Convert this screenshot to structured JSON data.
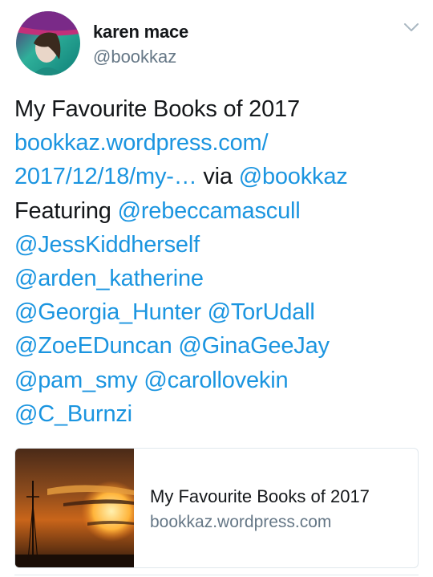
{
  "author": {
    "display_name": "karen mace",
    "handle": "@bookkaz"
  },
  "menu_icon": "chevron-down-icon",
  "tweet_lines": [
    [
      {
        "text": "My Favourite Books of 2017",
        "kind": "text"
      }
    ],
    [
      {
        "text": "bookkaz.wordpress.com/",
        "kind": "link"
      }
    ],
    [
      {
        "text": "2017/12/18/my-…",
        "kind": "link"
      },
      {
        "text": " via ",
        "kind": "text"
      },
      {
        "text": "@bookkaz",
        "kind": "link"
      }
    ],
    [
      {
        "text": "Featuring ",
        "kind": "text"
      },
      {
        "text": "@rebeccamascull",
        "kind": "link"
      }
    ],
    [
      {
        "text": "@JessKiddherself",
        "kind": "link"
      }
    ],
    [
      {
        "text": "@arden_katherine",
        "kind": "link"
      }
    ],
    [
      {
        "text": "@Georgia_Hunter",
        "kind": "link"
      },
      {
        "text": " ",
        "kind": "text"
      },
      {
        "text": "@TorUdall",
        "kind": "link"
      }
    ],
    [
      {
        "text": "@ZoeEDuncan",
        "kind": "link"
      },
      {
        "text": " ",
        "kind": "text"
      },
      {
        "text": "@GinaGeeJay",
        "kind": "link"
      }
    ],
    [
      {
        "text": "@pam_smy",
        "kind": "link"
      },
      {
        "text": " ",
        "kind": "text"
      },
      {
        "text": "@carollovekin",
        "kind": "link"
      }
    ],
    [
      {
        "text": "@C_Burnzi",
        "kind": "link"
      }
    ]
  ],
  "card": {
    "title": "My Favourite Books of 2017",
    "domain": "bookkaz.wordpress.com"
  },
  "colors": {
    "link": "#1b95e0",
    "text": "#14171a",
    "secondary": "#657786",
    "border": "#e1e8ed"
  }
}
